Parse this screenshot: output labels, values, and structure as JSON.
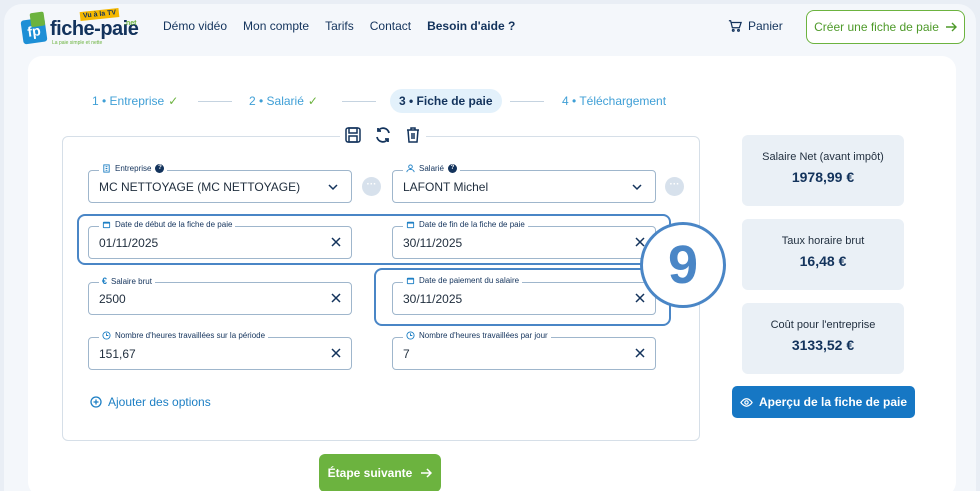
{
  "brand": {
    "logo_letters": "fp",
    "name": "fiche-paie",
    "suffix": ".net",
    "tv_badge": "Vu à la TV",
    "tagline": "La paie simple et nette"
  },
  "nav": {
    "items": [
      "Démo vidéo",
      "Mon compte",
      "Tarifs",
      "Contact",
      "Besoin d'aide ?"
    ],
    "cart_label": "Panier",
    "create_label": "Créer une fiche de paie"
  },
  "stepper": {
    "steps": [
      {
        "label": "1 • Entreprise",
        "status": "done"
      },
      {
        "label": "2 • Salarié",
        "status": "done"
      },
      {
        "label": "3 • Fiche de paie",
        "status": "active"
      },
      {
        "label": "4 • Téléchargement",
        "status": "future"
      }
    ]
  },
  "form": {
    "entreprise": {
      "label": "Entreprise",
      "value": "MC NETTOYAGE (MC NETTOYAGE)"
    },
    "salarie": {
      "label": "Salarié",
      "value": "LAFONT Michel"
    },
    "date_debut": {
      "label": "Date de début de la fiche de paie",
      "value": "01/11/2025"
    },
    "date_fin": {
      "label": "Date de fin de la fiche de paie",
      "value": "30/11/2025"
    },
    "salaire_brut": {
      "label": "Salaire brut",
      "value": "2500"
    },
    "date_paiement": {
      "label": "Date de paiement du salaire",
      "value": "30/11/2025"
    },
    "heures_periode": {
      "label": "Nombre d'heures travaillées sur la période",
      "value": "151,67"
    },
    "heures_jour": {
      "label": "Nombre d'heures travaillées par jour",
      "value": "7"
    },
    "more_symbol": "···",
    "add_options_label": "Ajouter des options",
    "next_label": "Étape suivante"
  },
  "annotation": {
    "number": "9",
    "color": "#4a86c6"
  },
  "summary": {
    "net": {
      "label": "Salaire Net (avant impôt)",
      "value": "1978,99 €"
    },
    "taux": {
      "label": "Taux horaire brut",
      "value": "16,48 €"
    },
    "cout": {
      "label": "Coût pour l'entreprise",
      "value": "3133,52 €"
    },
    "preview_label": "Aperçu de la fiche de paie"
  },
  "colors": {
    "green": "#6cb33f",
    "blue": "#1677c4",
    "navy": "#13335c"
  }
}
